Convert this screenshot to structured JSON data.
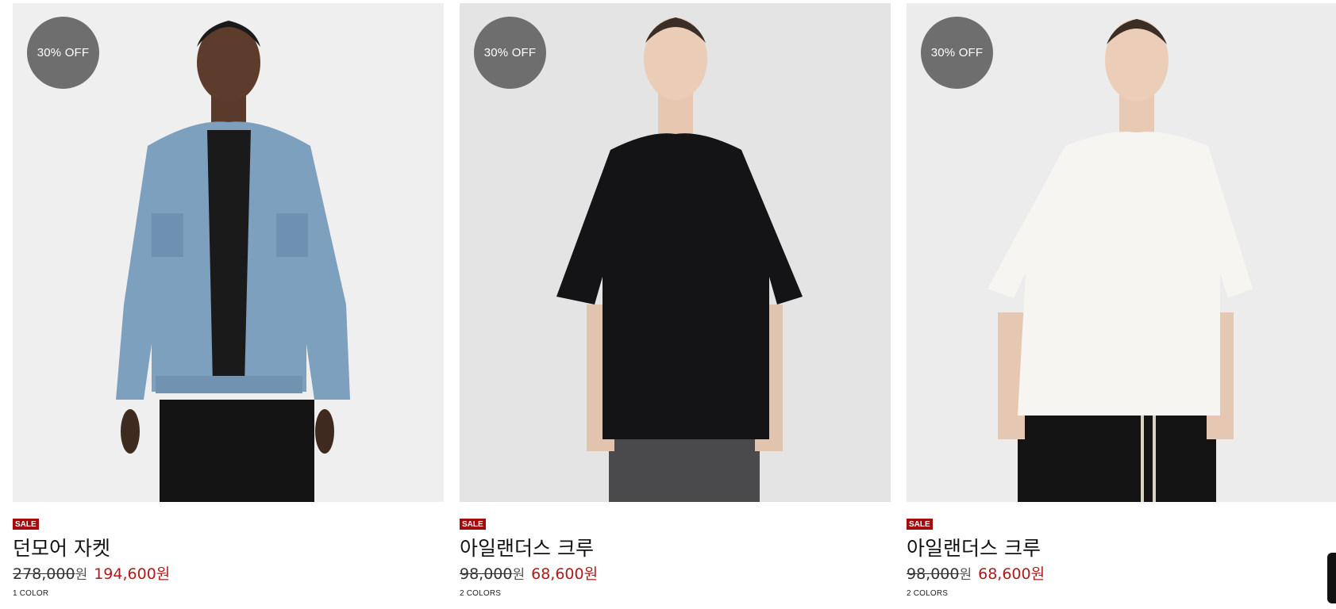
{
  "products": [
    {
      "badge": "30% OFF",
      "sale_tag": "SALE",
      "name": "던모어 자켓",
      "original_price": "278,000",
      "original_unit": "원",
      "sale_price": "194,600원",
      "colors": "1 COLOR"
    },
    {
      "badge": "30% OFF",
      "sale_tag": "SALE",
      "name": "아일랜더스 크루",
      "original_price": "98,000",
      "original_unit": "원",
      "sale_price": "68,600원",
      "colors": "2 COLORS"
    },
    {
      "badge": "30% OFF",
      "sale_tag": "SALE",
      "name": "아일랜더스 크루",
      "original_price": "98,000",
      "original_unit": "원",
      "sale_price": "68,600원",
      "colors": "2 COLORS"
    }
  ],
  "colors": {
    "badge_bg": "#6e6e6e",
    "sale_tag_bg": "#a30c0c",
    "sale_price": "#b01a1a"
  }
}
